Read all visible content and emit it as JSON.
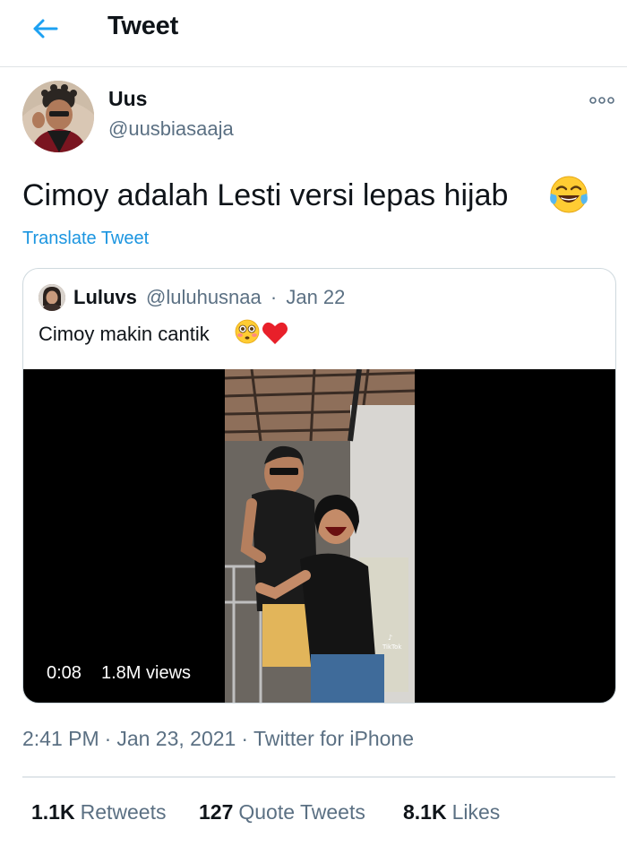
{
  "header": {
    "title": "Tweet",
    "back_icon": "arrow-left-icon",
    "accent_color": "#1da1f2"
  },
  "tweet": {
    "display_name": "Uus",
    "handle": "@uusbiasaaja",
    "text": "Cimoy adalah Lesti versi lepas hijab",
    "text_emoji": "face-with-tears-of-joy",
    "translate_label": "Translate Tweet",
    "more_icon": "more-options-icon"
  },
  "quote": {
    "display_name": "Luluvs",
    "handle": "@luluhusnaa",
    "separator": "·",
    "date": "Jan 22",
    "text": "Cimoy makin cantik",
    "text_emojis": [
      "flushed-face",
      "red-heart"
    ],
    "video": {
      "time": "0:08",
      "views": "1.8M views",
      "watermark": "TikTok"
    }
  },
  "meta": {
    "time": "2:41 PM",
    "separator": "·",
    "date": "Jan 23, 2021",
    "source": "Twitter for iPhone"
  },
  "stats": {
    "retweets_count": "1.1K",
    "retweets_label": "Retweets",
    "quote_count": "127",
    "quote_label": "Quote Tweets",
    "likes_count": "8.1K",
    "likes_label": "Likes"
  }
}
